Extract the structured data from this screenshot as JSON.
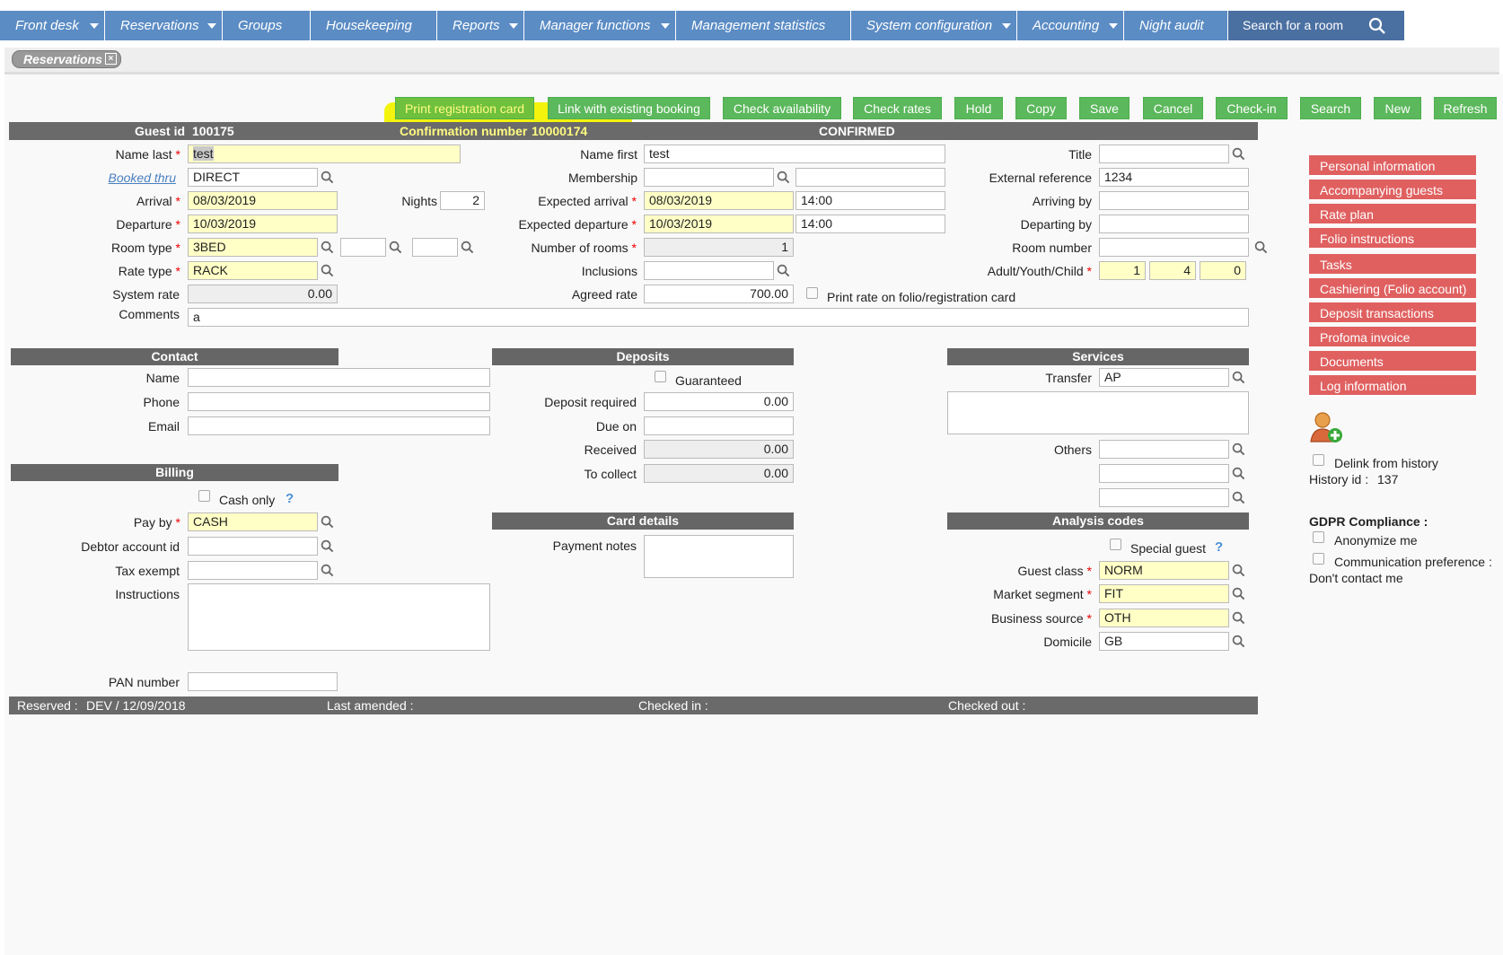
{
  "menu": {
    "items": [
      {
        "label": "Front desk"
      },
      {
        "label": "Reservations"
      },
      {
        "label": "Groups"
      },
      {
        "label": "Housekeeping"
      },
      {
        "label": "Reports"
      },
      {
        "label": "Manager functions"
      },
      {
        "label": "Management statistics"
      },
      {
        "label": "System configuration"
      },
      {
        "label": "Accounting"
      },
      {
        "label": "Night audit"
      }
    ],
    "search_label": "Search for a room"
  },
  "tab": {
    "label": "Reservations"
  },
  "toolbar": {
    "print_registration_card": "Print registration card",
    "link_existing_booking": "Link with existing booking",
    "check_availability": "Check availability",
    "check_rates": "Check rates",
    "hold": "Hold",
    "copy": "Copy",
    "save": "Save",
    "cancel": "Cancel",
    "check_in": "Check-in",
    "search": "Search",
    "new": "New",
    "refresh": "Refresh"
  },
  "header": {
    "guest_id_label": "Guest id",
    "guest_id": "100175",
    "confirmation_label": "Confirmation number",
    "confirmation_number": "10000174",
    "status": "CONFIRMED"
  },
  "form": {
    "name_last_label": "Name last",
    "name_last": "test",
    "booked_thru_label": "Booked thru",
    "booked_thru": "DIRECT",
    "arrival_label": "Arrival",
    "arrival": "08/03/2019",
    "nights_label": "Nights",
    "nights": "2",
    "departure_label": "Departure",
    "departure": "10/03/2019",
    "room_type_label": "Room type",
    "room_type": "3BED",
    "rate_type_label": "Rate type",
    "rate_type": "RACK",
    "system_rate_label": "System rate",
    "system_rate": "0.00",
    "comments_label": "Comments",
    "comments": "a",
    "name_first_label": "Name first",
    "name_first": "test",
    "membership_label": "Membership",
    "expected_arrival_label": "Expected arrival",
    "expected_arrival_date": "08/03/2019",
    "expected_arrival_time": "14:00",
    "expected_departure_label": "Expected departure",
    "expected_departure_date": "10/03/2019",
    "expected_departure_time": "14:00",
    "number_of_rooms_label": "Number of rooms",
    "number_of_rooms": "1",
    "inclusions_label": "Inclusions",
    "agreed_rate_label": "Agreed rate",
    "agreed_rate": "700.00",
    "print_rate_label": "Print rate on folio/registration card",
    "title_label": "Title",
    "external_reference_label": "External reference",
    "external_reference": "1234",
    "arriving_by_label": "Arriving by",
    "departing_by_label": "Departing by",
    "room_number_label": "Room number",
    "adult_youth_child_label": "Adult/Youth/Child",
    "adults": "1",
    "youth": "4",
    "children": "0"
  },
  "contact": {
    "title": "Contact",
    "name_label": "Name",
    "phone_label": "Phone",
    "email_label": "Email"
  },
  "billing": {
    "title": "Billing",
    "cash_only_label": "Cash only",
    "pay_by_label": "Pay by",
    "pay_by": "CASH",
    "debtor_account_label": "Debtor account id",
    "tax_exempt_label": "Tax exempt",
    "instructions_label": "Instructions",
    "pan_number_label": "PAN number"
  },
  "deposits": {
    "title": "Deposits",
    "guaranteed_label": "Guaranteed",
    "deposit_required_label": "Deposit required",
    "deposit_required": "0.00",
    "due_on_label": "Due on",
    "received_label": "Received",
    "received": "0.00",
    "to_collect_label": "To collect",
    "to_collect": "0.00"
  },
  "card_details": {
    "title": "Card details",
    "payment_notes_label": "Payment notes"
  },
  "services": {
    "title": "Services",
    "transfer_label": "Transfer",
    "transfer": "AP",
    "others_label": "Others"
  },
  "analysis": {
    "title": "Analysis codes",
    "special_guest_label": "Special guest",
    "guest_class_label": "Guest class",
    "guest_class": "NORM",
    "market_segment_label": "Market segment",
    "market_segment": "FIT",
    "business_source_label": "Business source",
    "business_source": "OTH",
    "domicile_label": "Domicile",
    "domicile": "GB"
  },
  "side": {
    "items": [
      {
        "label": "Personal information"
      },
      {
        "label": "Accompanying guests"
      },
      {
        "label": "Rate plan"
      },
      {
        "label": "Folio instructions"
      },
      {
        "label": "Tasks"
      },
      {
        "label": "Cashiering (Folio account)"
      },
      {
        "label": "Deposit transactions"
      },
      {
        "label": "Profoma invoice"
      },
      {
        "label": "Documents"
      },
      {
        "label": "Log information"
      }
    ],
    "delink_label": "Delink from history",
    "history_id_label": "History id :",
    "history_id": "137",
    "gdpr_label": "GDPR Compliance :",
    "anonymize_label": "Anonymize me",
    "communication_label": "Communication preference :",
    "dont_contact": "Don't contact me"
  },
  "footer": {
    "reserved_label": "Reserved :",
    "reserved_value": "DEV / 12/09/2018",
    "last_amended_label": "Last amended :",
    "checked_in_label": "Checked in :",
    "checked_out_label": "Checked out :"
  },
  "colors": {
    "menu_bg": "#5b8cc4",
    "green_button": "#5cb85c",
    "side_button": "#e06060",
    "required_field": "#ffffc6",
    "highlight": "#f3f200"
  }
}
